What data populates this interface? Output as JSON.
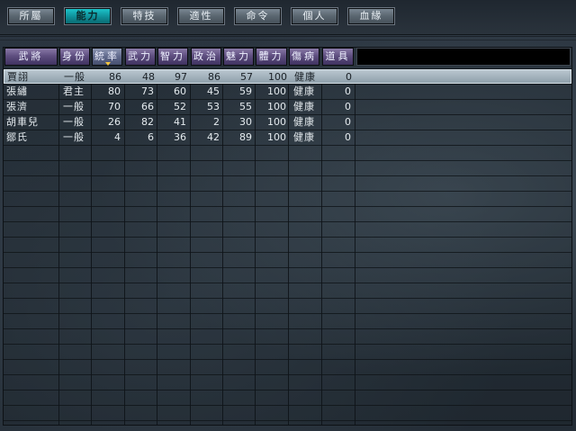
{
  "tabs": [
    {
      "label": "所屬",
      "active": false
    },
    {
      "label": "能力",
      "active": true
    },
    {
      "label": "特技",
      "active": false
    },
    {
      "label": "適性",
      "active": false
    },
    {
      "label": "命令",
      "active": false
    },
    {
      "label": "個人",
      "active": false
    },
    {
      "label": "血緣",
      "active": false
    }
  ],
  "table": {
    "columns": [
      "武將",
      "身份",
      "統率",
      "武力",
      "智力",
      "政治",
      "魅力",
      "體力",
      "傷病",
      "道具"
    ],
    "sorted_column": "統率",
    "rows": [
      {
        "name": "賈詡",
        "rank": "一般",
        "lead": "86",
        "war": "48",
        "int": "97",
        "pol": "86",
        "cha": "57",
        "hp": "100",
        "health": "健康",
        "items": "0"
      },
      {
        "name": "張繡",
        "rank": "君主",
        "lead": "80",
        "war": "73",
        "int": "60",
        "pol": "45",
        "cha": "59",
        "hp": "100",
        "health": "健康",
        "items": "0"
      },
      {
        "name": "張濟",
        "rank": "一般",
        "lead": "70",
        "war": "66",
        "int": "52",
        "pol": "53",
        "cha": "55",
        "hp": "100",
        "health": "健康",
        "items": "0"
      },
      {
        "name": "胡車兒",
        "rank": "一般",
        "lead": "26",
        "war": "82",
        "int": "41",
        "pol": "2",
        "cha": "30",
        "hp": "100",
        "health": "健康",
        "items": "0"
      },
      {
        "name": "鄒氏",
        "rank": "一般",
        "lead": "4",
        "war": "6",
        "int": "36",
        "pol": "42",
        "cha": "89",
        "hp": "100",
        "health": "健康",
        "items": "0"
      }
    ]
  },
  "colors": {
    "tab_active": "#1cc3c9",
    "header": "#5f4f80",
    "selected_row": "#a9b8c2",
    "sort_marker": "#f3c640"
  }
}
